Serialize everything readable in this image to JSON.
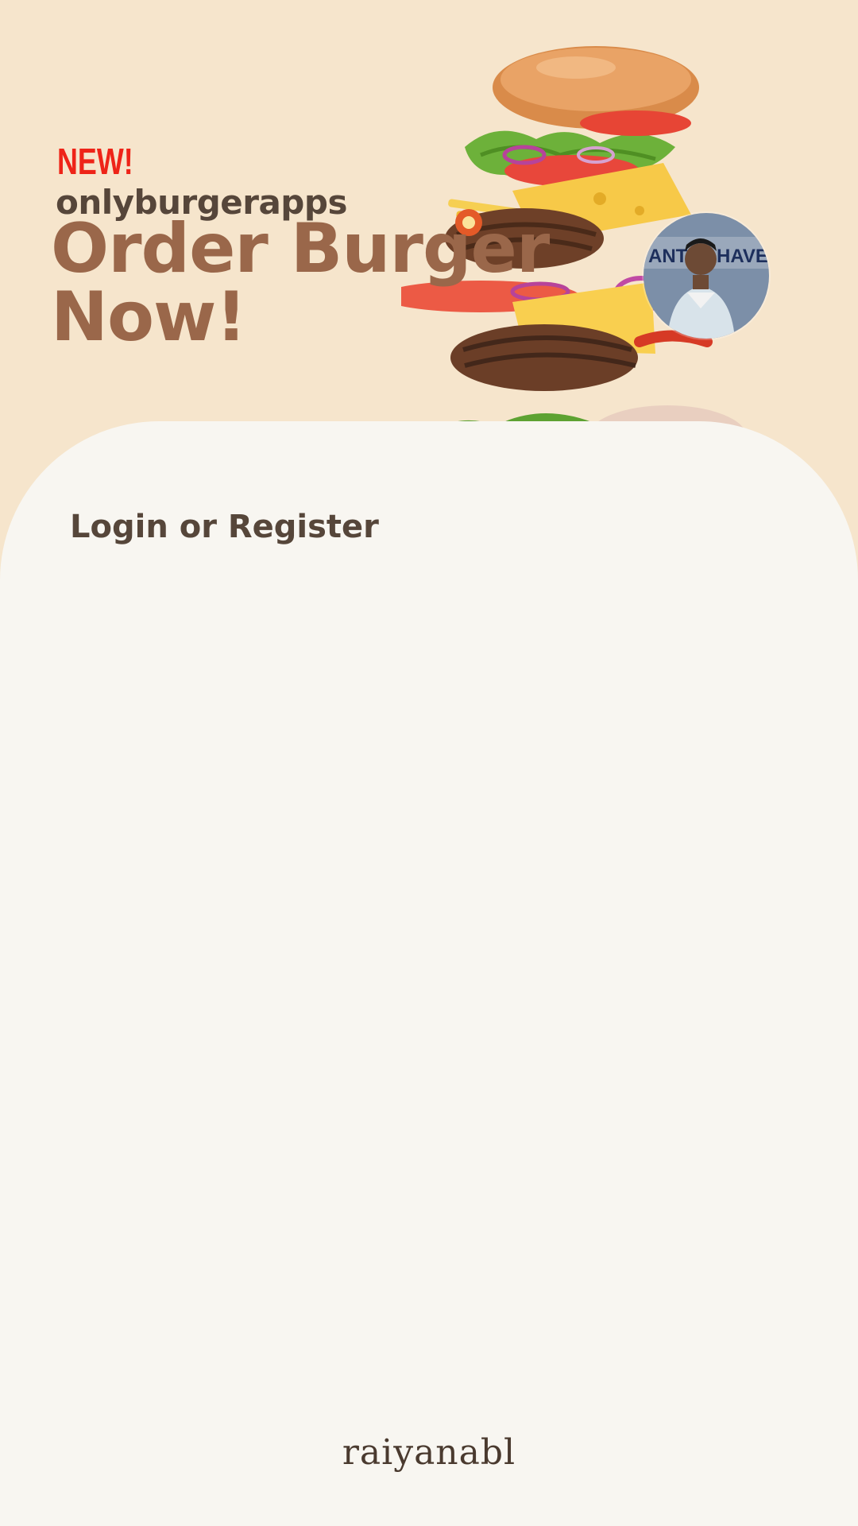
{
  "hero": {
    "new_tag": "NEW!",
    "brand": "onlyburgerapps",
    "headline_line1": "Order Burger",
    "headline_line2": "Now!"
  },
  "avatar": {
    "icon": "user-avatar"
  },
  "panel": {
    "title": "Login or Register"
  },
  "footer": {
    "brand": "raiyanabl"
  },
  "colors": {
    "hero_bg": "#f6e5cc",
    "panel_bg": "#f8f6f1",
    "new_tag": "#ee2418",
    "headline": "#9a674a",
    "text_dark": "#56463a"
  }
}
